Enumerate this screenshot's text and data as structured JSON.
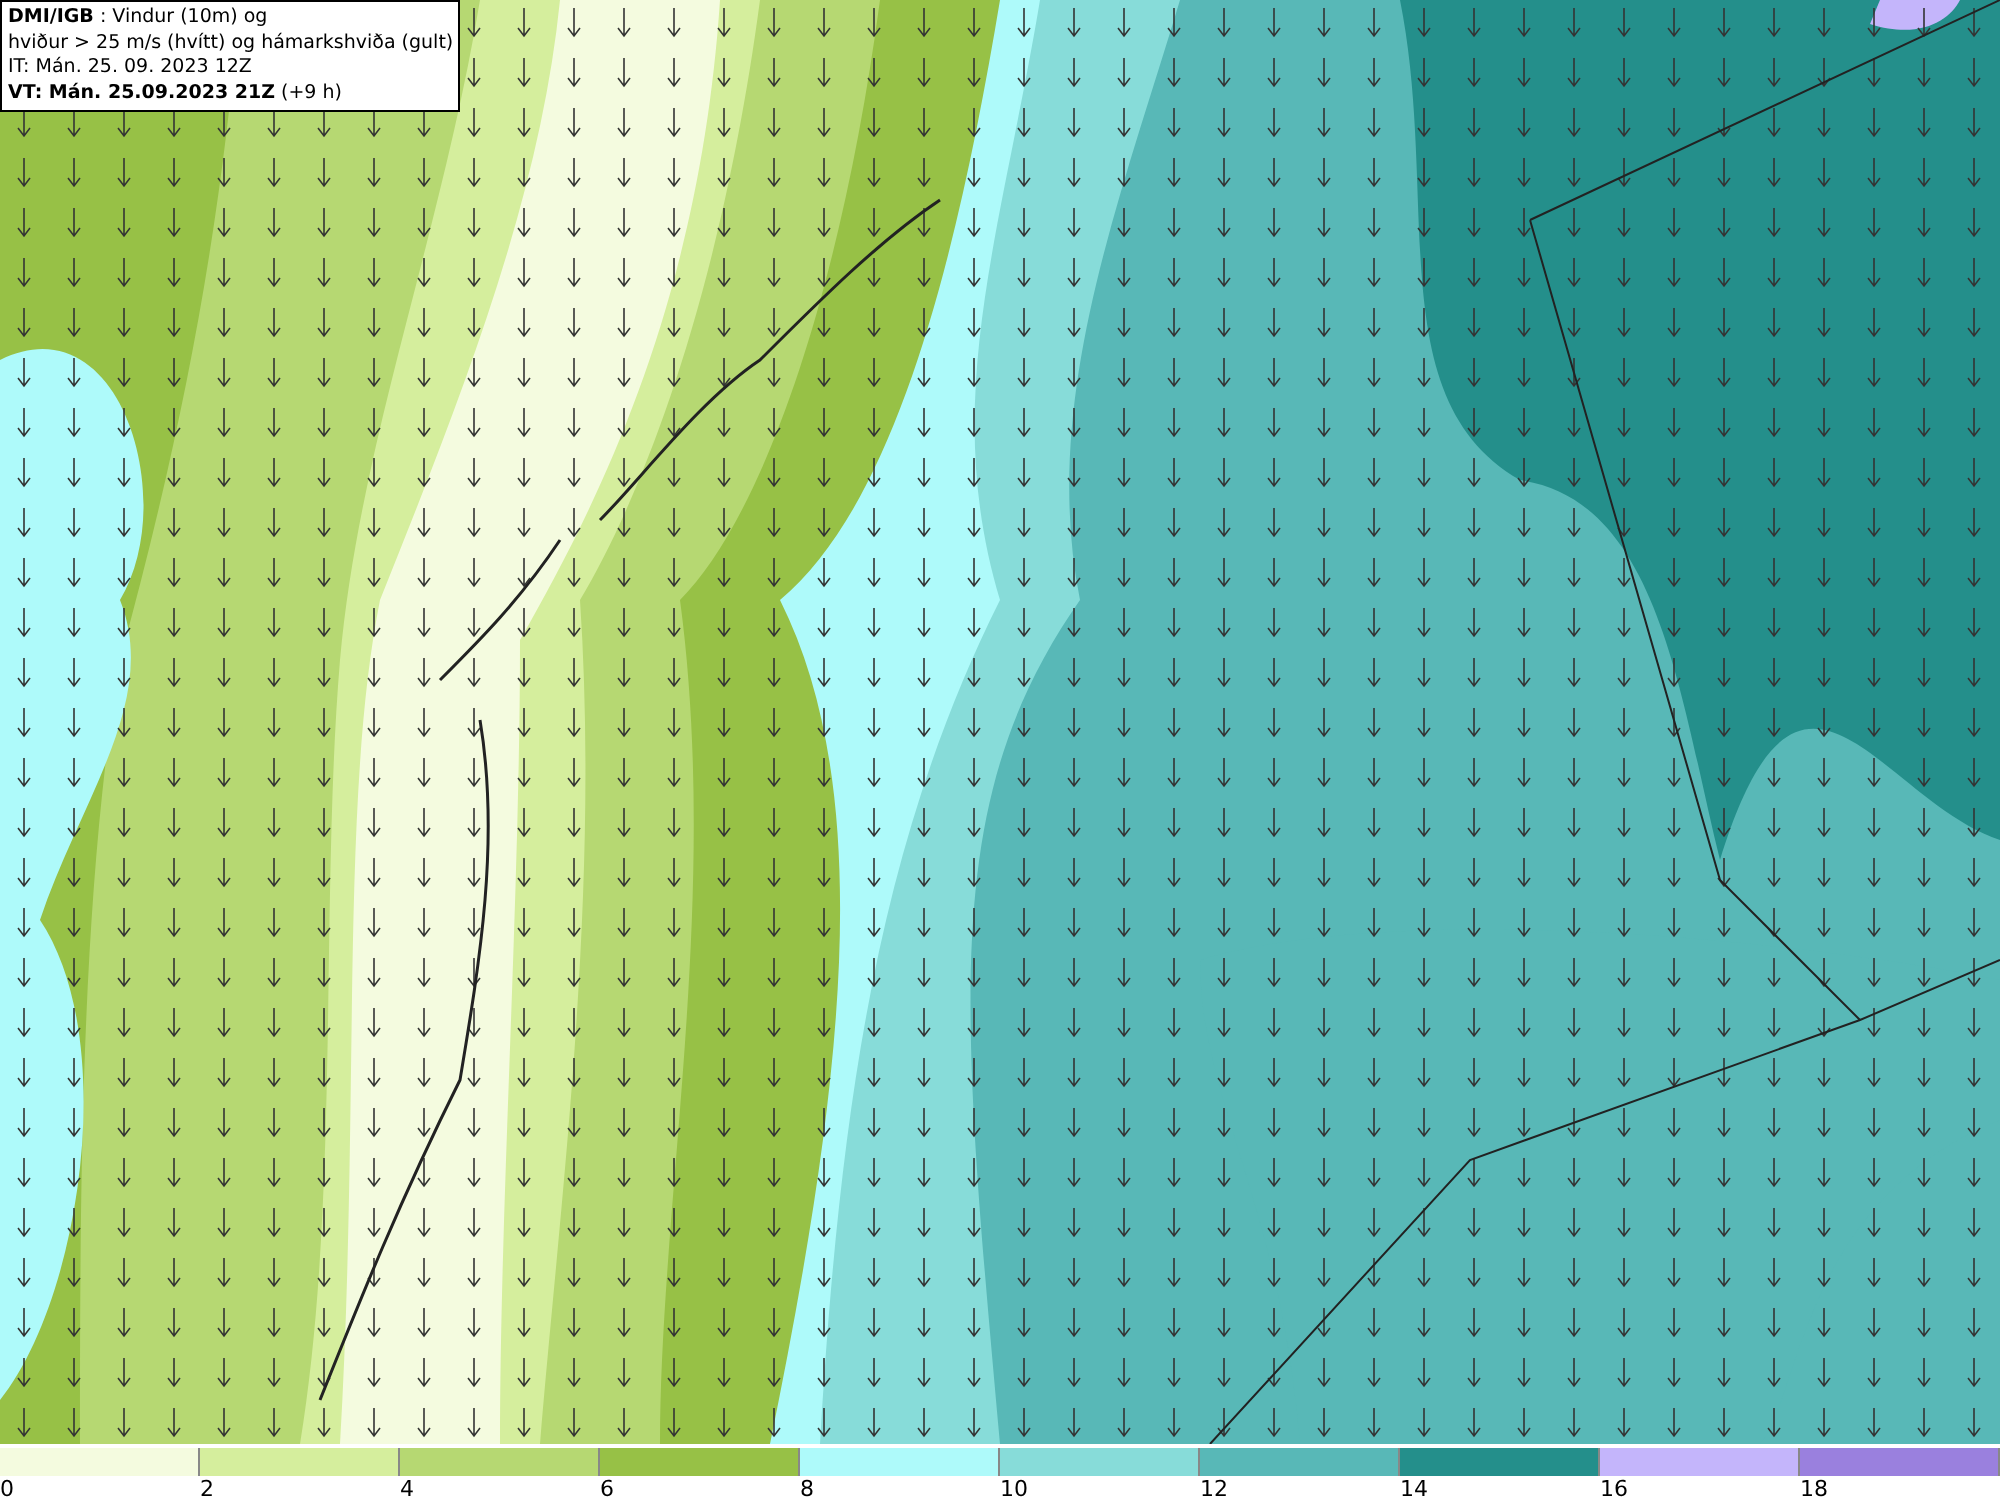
{
  "info_box": {
    "lines": [
      "**DMI/IGB** : Vindur (10m) og",
      "hviður > 25 m/s (hvítt) og hámarkshviða (gult)",
      "IT: Mán. 25. 09. 2023 12Z",
      "**VT: Mán. 25.09.2023 21Z** (+9 h)"
    ]
  },
  "legend": [
    {
      "label": "0",
      "color": "#f4fbdf"
    },
    {
      "label": "2",
      "color": "#d5ee9d"
    },
    {
      "label": "4",
      "color": "#b6d872"
    },
    {
      "label": "6",
      "color": "#97c146"
    },
    {
      "label": "8",
      "color": "#aefafa"
    },
    {
      "label": "10",
      "color": "#87dcd9"
    },
    {
      "label": "12",
      "color": "#58b8b7"
    },
    {
      "label": "14",
      "color": "#248f8b"
    },
    {
      "label": "16",
      "color": "#c4b5fb"
    },
    {
      "label": "18",
      "color": "#9a80de"
    }
  ]
}
